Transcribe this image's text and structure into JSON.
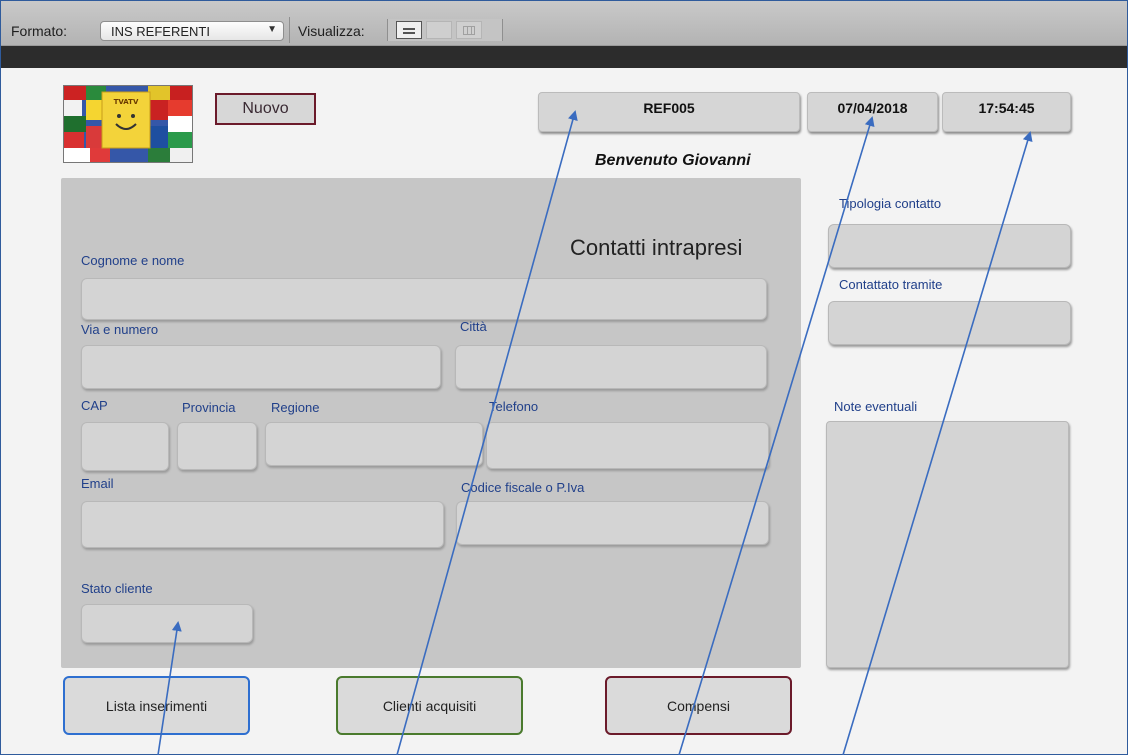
{
  "toolbar": {
    "formato_label": "Formato:",
    "formato_value": "INS REFERENTI",
    "visualizza_label": "Visualizza:",
    "view_modes": [
      "form-view-icon",
      "list-view-icon",
      "table-view-icon"
    ]
  },
  "header": {
    "nuovo_label": "Nuovo",
    "ref_code": "REF005",
    "date": "07/04/2018",
    "time": "17:54:45",
    "welcome": "Benvenuto Giovanni"
  },
  "form": {
    "title": "Contatti intrapresi",
    "labels": {
      "cognome_nome": "Cognome e nome",
      "via_numero": "Via e numero",
      "citta": "Città",
      "cap": "CAP",
      "provincia": "Provincia",
      "regione": "Regione",
      "telefono": "Telefono",
      "email": "Email",
      "codice_fiscale": "Codice fiscale o P.Iva",
      "stato_cliente": "Stato cliente"
    }
  },
  "side": {
    "tipologia": "Tipologia contatto",
    "contattato": "Contattato tramite",
    "note": "Note eventuali"
  },
  "buttons": {
    "lista": "Lista inserimenti",
    "clienti": "Clienti acquisiti",
    "compensi": "Compensi"
  },
  "colors": {
    "label_blue": "#21408a",
    "annotation_arrow": "#3a6cc0",
    "nuovo_border": "#6b1a2a",
    "lista_border": "#2e6fd0",
    "clienti_border": "#4a7a2d",
    "compensi_border": "#6b1a2a"
  }
}
